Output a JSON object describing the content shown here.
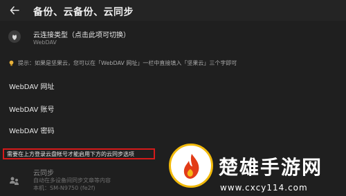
{
  "header": {
    "title": "备份、云备份、云同步"
  },
  "cloud_type": {
    "title": "云连接类型（点击此项可切换）",
    "value": "WebDAV"
  },
  "tip": "提示：如果是坚果云，您可以在「WebDAV 网址」一栏中直接填入「坚果云」三个字即可",
  "fields": [
    {
      "label": "WebDAV 网址"
    },
    {
      "label": "WebDAV 账号"
    },
    {
      "label": "WebDAV 密码"
    }
  ],
  "warning": "需要在上方登录云盘帐号才能启用下方的云同步选项",
  "sync": {
    "title": "云同步",
    "description": "自动在多设备间同步文章等内容",
    "device": "本机：SM-N9750 (fe2f)"
  },
  "watermark": {
    "name": "楚雄手游网",
    "url": "www.cxcy114.com"
  },
  "colors": {
    "warning_border": "#d61a1a",
    "background": "#1f1f1f",
    "logo_ring": "#f1b90a"
  },
  "icons": {
    "back": "arrow-left-icon",
    "cloud": "cloud-leaf-icon",
    "tip": "lightbulb-icon",
    "sync": "sync-users-icon"
  }
}
